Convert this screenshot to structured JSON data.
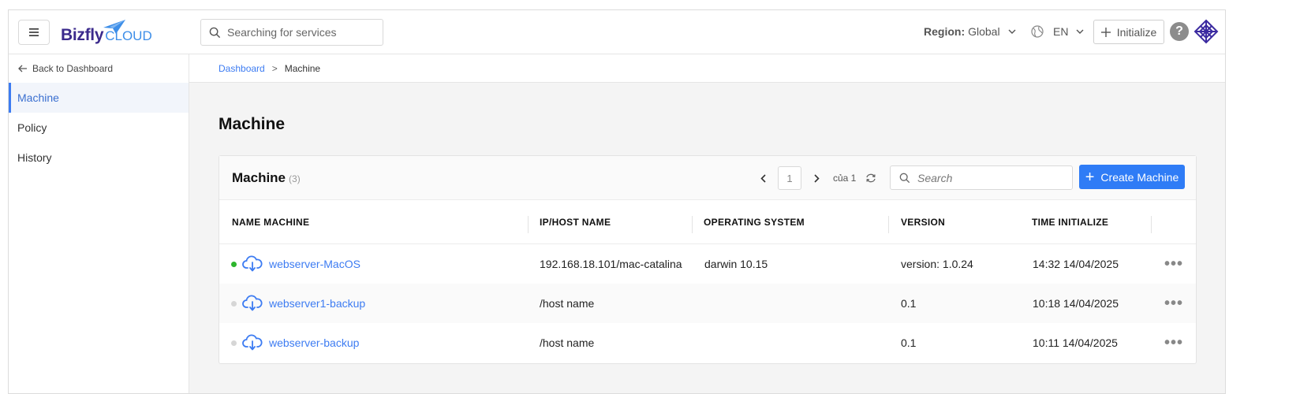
{
  "header": {
    "logo_main": "Bizfly",
    "logo_sub": "CLOUD",
    "search_placeholder": "Searching for services",
    "region_label": "Region:",
    "region_value": "Global",
    "language": "EN",
    "initialize_label": "Initialize",
    "help_label": "?"
  },
  "sidebar": {
    "back_label": "Back to Dashboard",
    "items": [
      {
        "label": "Machine",
        "active": true
      },
      {
        "label": "Policy",
        "active": false
      },
      {
        "label": "History",
        "active": false
      }
    ]
  },
  "breadcrumb": {
    "root": "Dashboard",
    "separator": ">",
    "current": "Machine"
  },
  "page": {
    "title": "Machine"
  },
  "card": {
    "title": "Machine",
    "count": "(3)",
    "pager": {
      "page": "1",
      "of_label": "của 1"
    },
    "search_placeholder": "Search",
    "create_label": "Create Machine"
  },
  "table": {
    "columns": [
      "NAME MACHINE",
      "IP/HOST NAME",
      "OPERATING SYSTEM",
      "VERSION",
      "TIME INITIALIZE"
    ],
    "rows": [
      {
        "name": "webserver-MacOS",
        "host": "192.168.18.101/mac-catalina",
        "os": "darwin 10.15",
        "version": "version: 1.0.24",
        "time": "14:32 14/04/2025",
        "status": "online"
      },
      {
        "name": "webserver1-backup",
        "host": "/host name",
        "os": "",
        "version": "0.1",
        "time": "10:18 14/04/2025",
        "status": "offline"
      },
      {
        "name": "webserver-backup",
        "host": "/host name",
        "os": "",
        "version": "0.1",
        "time": "10:11 14/04/2025",
        "status": "offline"
      }
    ]
  },
  "colors": {
    "accent": "#2f7cf6",
    "link": "#3d7cf2",
    "online": "#2db52d",
    "offline": "#d6d6d6",
    "logo_purple": "#3b2a8c"
  },
  "icons": {
    "menu": "hamburger-icon",
    "search": "search-icon",
    "globe": "globe-icon",
    "plus": "plus-icon",
    "help": "question-icon",
    "back": "arrow-left-icon",
    "prev": "chevron-left-icon",
    "next": "chevron-right-icon",
    "refresh": "refresh-icon",
    "machine": "cloud-sync-icon",
    "more": "more-horizontal-icon"
  }
}
